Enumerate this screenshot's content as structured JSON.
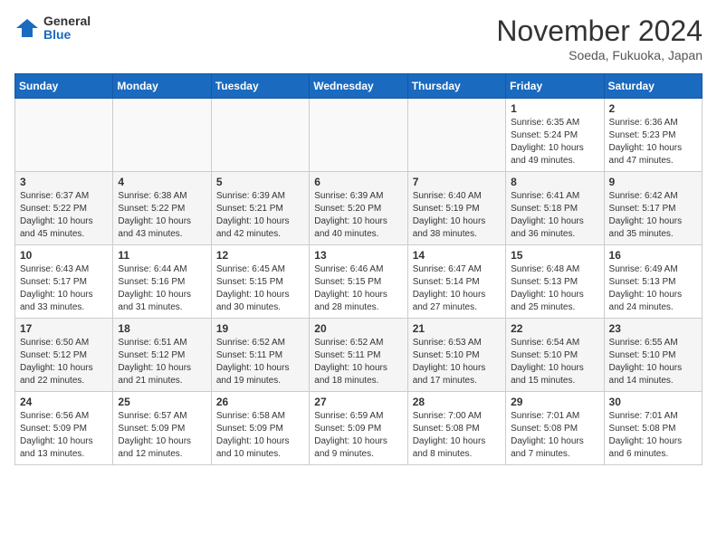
{
  "header": {
    "logo": {
      "general": "General",
      "blue": "Blue"
    },
    "title": "November 2024",
    "location": "Soeda, Fukuoka, Japan"
  },
  "calendar": {
    "days": [
      "Sunday",
      "Monday",
      "Tuesday",
      "Wednesday",
      "Thursday",
      "Friday",
      "Saturday"
    ],
    "weeks": [
      [
        {
          "day": "",
          "empty": true
        },
        {
          "day": "",
          "empty": true
        },
        {
          "day": "",
          "empty": true
        },
        {
          "day": "",
          "empty": true
        },
        {
          "day": "",
          "empty": true
        },
        {
          "day": "1",
          "sunrise": "Sunrise: 6:35 AM",
          "sunset": "Sunset: 5:24 PM",
          "daylight": "Daylight: 10 hours and 49 minutes."
        },
        {
          "day": "2",
          "sunrise": "Sunrise: 6:36 AM",
          "sunset": "Sunset: 5:23 PM",
          "daylight": "Daylight: 10 hours and 47 minutes."
        }
      ],
      [
        {
          "day": "3",
          "sunrise": "Sunrise: 6:37 AM",
          "sunset": "Sunset: 5:22 PM",
          "daylight": "Daylight: 10 hours and 45 minutes."
        },
        {
          "day": "4",
          "sunrise": "Sunrise: 6:38 AM",
          "sunset": "Sunset: 5:22 PM",
          "daylight": "Daylight: 10 hours and 43 minutes."
        },
        {
          "day": "5",
          "sunrise": "Sunrise: 6:39 AM",
          "sunset": "Sunset: 5:21 PM",
          "daylight": "Daylight: 10 hours and 42 minutes."
        },
        {
          "day": "6",
          "sunrise": "Sunrise: 6:39 AM",
          "sunset": "Sunset: 5:20 PM",
          "daylight": "Daylight: 10 hours and 40 minutes."
        },
        {
          "day": "7",
          "sunrise": "Sunrise: 6:40 AM",
          "sunset": "Sunset: 5:19 PM",
          "daylight": "Daylight: 10 hours and 38 minutes."
        },
        {
          "day": "8",
          "sunrise": "Sunrise: 6:41 AM",
          "sunset": "Sunset: 5:18 PM",
          "daylight": "Daylight: 10 hours and 36 minutes."
        },
        {
          "day": "9",
          "sunrise": "Sunrise: 6:42 AM",
          "sunset": "Sunset: 5:17 PM",
          "daylight": "Daylight: 10 hours and 35 minutes."
        }
      ],
      [
        {
          "day": "10",
          "sunrise": "Sunrise: 6:43 AM",
          "sunset": "Sunset: 5:17 PM",
          "daylight": "Daylight: 10 hours and 33 minutes."
        },
        {
          "day": "11",
          "sunrise": "Sunrise: 6:44 AM",
          "sunset": "Sunset: 5:16 PM",
          "daylight": "Daylight: 10 hours and 31 minutes."
        },
        {
          "day": "12",
          "sunrise": "Sunrise: 6:45 AM",
          "sunset": "Sunset: 5:15 PM",
          "daylight": "Daylight: 10 hours and 30 minutes."
        },
        {
          "day": "13",
          "sunrise": "Sunrise: 6:46 AM",
          "sunset": "Sunset: 5:15 PM",
          "daylight": "Daylight: 10 hours and 28 minutes."
        },
        {
          "day": "14",
          "sunrise": "Sunrise: 6:47 AM",
          "sunset": "Sunset: 5:14 PM",
          "daylight": "Daylight: 10 hours and 27 minutes."
        },
        {
          "day": "15",
          "sunrise": "Sunrise: 6:48 AM",
          "sunset": "Sunset: 5:13 PM",
          "daylight": "Daylight: 10 hours and 25 minutes."
        },
        {
          "day": "16",
          "sunrise": "Sunrise: 6:49 AM",
          "sunset": "Sunset: 5:13 PM",
          "daylight": "Daylight: 10 hours and 24 minutes."
        }
      ],
      [
        {
          "day": "17",
          "sunrise": "Sunrise: 6:50 AM",
          "sunset": "Sunset: 5:12 PM",
          "daylight": "Daylight: 10 hours and 22 minutes."
        },
        {
          "day": "18",
          "sunrise": "Sunrise: 6:51 AM",
          "sunset": "Sunset: 5:12 PM",
          "daylight": "Daylight: 10 hours and 21 minutes."
        },
        {
          "day": "19",
          "sunrise": "Sunrise: 6:52 AM",
          "sunset": "Sunset: 5:11 PM",
          "daylight": "Daylight: 10 hours and 19 minutes."
        },
        {
          "day": "20",
          "sunrise": "Sunrise: 6:52 AM",
          "sunset": "Sunset: 5:11 PM",
          "daylight": "Daylight: 10 hours and 18 minutes."
        },
        {
          "day": "21",
          "sunrise": "Sunrise: 6:53 AM",
          "sunset": "Sunset: 5:10 PM",
          "daylight": "Daylight: 10 hours and 17 minutes."
        },
        {
          "day": "22",
          "sunrise": "Sunrise: 6:54 AM",
          "sunset": "Sunset: 5:10 PM",
          "daylight": "Daylight: 10 hours and 15 minutes."
        },
        {
          "day": "23",
          "sunrise": "Sunrise: 6:55 AM",
          "sunset": "Sunset: 5:10 PM",
          "daylight": "Daylight: 10 hours and 14 minutes."
        }
      ],
      [
        {
          "day": "24",
          "sunrise": "Sunrise: 6:56 AM",
          "sunset": "Sunset: 5:09 PM",
          "daylight": "Daylight: 10 hours and 13 minutes."
        },
        {
          "day": "25",
          "sunrise": "Sunrise: 6:57 AM",
          "sunset": "Sunset: 5:09 PM",
          "daylight": "Daylight: 10 hours and 12 minutes."
        },
        {
          "day": "26",
          "sunrise": "Sunrise: 6:58 AM",
          "sunset": "Sunset: 5:09 PM",
          "daylight": "Daylight: 10 hours and 10 minutes."
        },
        {
          "day": "27",
          "sunrise": "Sunrise: 6:59 AM",
          "sunset": "Sunset: 5:09 PM",
          "daylight": "Daylight: 10 hours and 9 minutes."
        },
        {
          "day": "28",
          "sunrise": "Sunrise: 7:00 AM",
          "sunset": "Sunset: 5:08 PM",
          "daylight": "Daylight: 10 hours and 8 minutes."
        },
        {
          "day": "29",
          "sunrise": "Sunrise: 7:01 AM",
          "sunset": "Sunset: 5:08 PM",
          "daylight": "Daylight: 10 hours and 7 minutes."
        },
        {
          "day": "30",
          "sunrise": "Sunrise: 7:01 AM",
          "sunset": "Sunset: 5:08 PM",
          "daylight": "Daylight: 10 hours and 6 minutes."
        }
      ]
    ]
  }
}
